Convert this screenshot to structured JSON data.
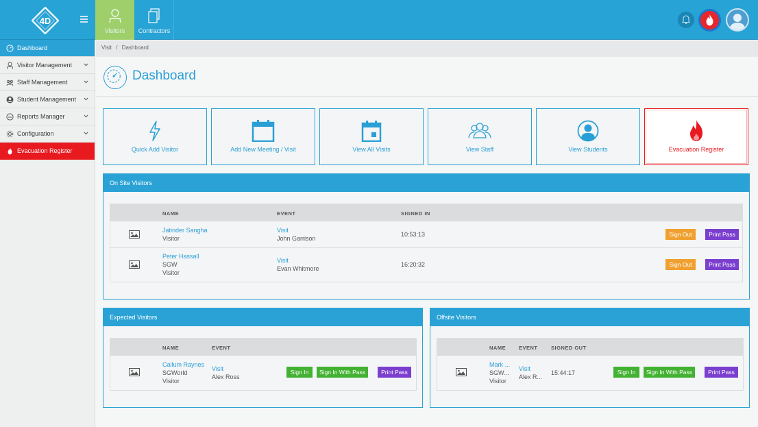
{
  "header": {
    "nav": [
      {
        "label": "Visitors",
        "active": true
      },
      {
        "label": "Contractors",
        "active": false
      }
    ]
  },
  "sidebar": {
    "items": [
      {
        "label": "Dashboard",
        "icon": "dashboard-icon",
        "active": true,
        "chevron": false
      },
      {
        "label": "Visitor Management",
        "icon": "person-icon",
        "chevron": true
      },
      {
        "label": "Staff Management",
        "icon": "group-icon",
        "chevron": true
      },
      {
        "label": "Student Management",
        "icon": "student-icon",
        "chevron": true
      },
      {
        "label": "Reports Manager",
        "icon": "reports-icon",
        "chevron": true
      },
      {
        "label": "Configuration",
        "icon": "gear-icon",
        "chevron": true
      },
      {
        "label": "Evacuation Register",
        "icon": "fire-icon",
        "chevron": false,
        "alert": true
      }
    ]
  },
  "breadcrumb": {
    "items": [
      "Visit",
      "Dashboard"
    ],
    "separator": "/"
  },
  "page": {
    "title": "Dashboard"
  },
  "tiles": [
    {
      "label": "Quick Add Visitor",
      "icon": "lightning-icon"
    },
    {
      "label": "Add New Meeting / Visit",
      "icon": "calendar-icon"
    },
    {
      "label": "View All Visits",
      "icon": "calendar-day-icon"
    },
    {
      "label": "View Staff",
      "icon": "people-icon"
    },
    {
      "label": "View Students",
      "icon": "user-circle-icon"
    },
    {
      "label": "Evacuation Register",
      "icon": "fire-icon"
    }
  ],
  "onsite": {
    "title": "On Site Visitors",
    "columns": [
      "NAME",
      "EVENT",
      "SIGNED IN"
    ],
    "rows": [
      {
        "name": "Jatinder Sangha",
        "sub": [
          "Visitor"
        ],
        "event": "Visit",
        "host": "John Garrison",
        "time": "10:53:13",
        "btn1": "Sign Out",
        "btn2": "Print Pass"
      },
      {
        "name": "Peter Hassall",
        "sub": [
          "SGW",
          "Visitor"
        ],
        "event": "Visit",
        "host": "Evan Whitmore",
        "time": "16:20:32",
        "btn1": "Sign Out",
        "btn2": "Print Pass"
      }
    ]
  },
  "expected": {
    "title": "Expected Visitors",
    "columns": [
      "NAME",
      "EVENT"
    ],
    "rows": [
      {
        "name": "Callum Raynes",
        "sub": [
          "SGWorld",
          "Visitor"
        ],
        "event": "Visit",
        "host": "Alex Ross",
        "btn1": "Sign In",
        "btn2": "Sign In With Pass",
        "btn3": "Print Pass"
      }
    ]
  },
  "offsite": {
    "title": "Offsite Visitors",
    "columns": [
      "NAME",
      "EVENT",
      "SIGNED OUT"
    ],
    "rows": [
      {
        "name": "Mark ...",
        "sub": [
          "SGW...",
          "Visitor"
        ],
        "event": "Visit",
        "host": "Alex R...",
        "time": "15:44:17",
        "btn1": "Sign In",
        "btn2": "Sign In With Pass",
        "btn3": "Print Pass"
      }
    ]
  },
  "colors": {
    "primary": "#2aa2d5",
    "alert": "#e8191f",
    "orange": "#f0a030",
    "purple": "#7b3fcf",
    "green": "#43b232",
    "visitorsTab": "#9ecf6a"
  }
}
